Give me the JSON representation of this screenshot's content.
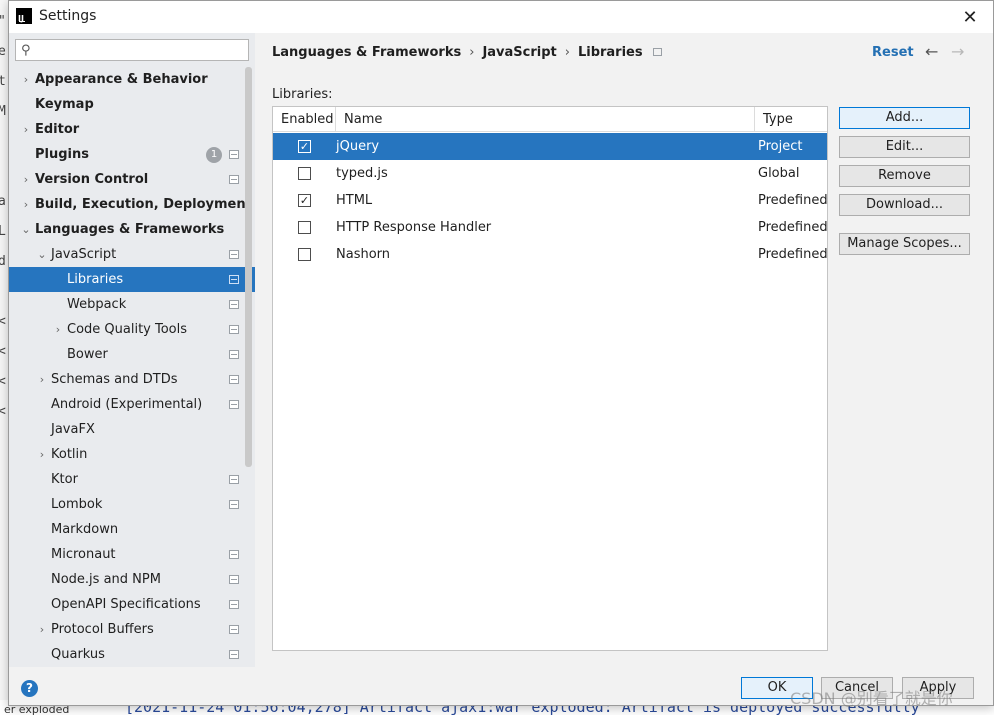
{
  "window": {
    "title": "Settings",
    "close_glyph": "✕"
  },
  "background": {
    "left_glyphs": [
      "\"",
      "e",
      "t",
      "M",
      "",
      "",
      "a",
      "L",
      "d",
      "",
      "<",
      "<",
      "<",
      "<"
    ],
    "bottom_left": "er exploded",
    "bottom_log": "[2021-11-24 01:56:04,278] Artifact ajax1:war exploded: Artifact is deployed successfully"
  },
  "sidebar": {
    "search_placeholder": "",
    "items": [
      {
        "label": "Appearance & Behavior",
        "bold": true,
        "chevron": "›",
        "indent": 0,
        "config": false
      },
      {
        "label": "Keymap",
        "bold": true,
        "chevron": "",
        "indent": 0,
        "config": false
      },
      {
        "label": "Editor",
        "bold": true,
        "chevron": "›",
        "indent": 0,
        "config": false
      },
      {
        "label": "Plugins",
        "bold": true,
        "chevron": "",
        "indent": 0,
        "config": true,
        "badge": "1"
      },
      {
        "label": "Version Control",
        "bold": true,
        "chevron": "›",
        "indent": 0,
        "config": true
      },
      {
        "label": "Build, Execution, Deployment",
        "bold": true,
        "chevron": "›",
        "indent": 0,
        "config": false
      },
      {
        "label": "Languages & Frameworks",
        "bold": true,
        "chevron": "⌄",
        "indent": 0,
        "config": false
      },
      {
        "label": "JavaScript",
        "bold": false,
        "chevron": "⌄",
        "indent": 1,
        "config": true
      },
      {
        "label": "Libraries",
        "bold": false,
        "chevron": "",
        "indent": 2,
        "config": true,
        "selected": true
      },
      {
        "label": "Webpack",
        "bold": false,
        "chevron": "",
        "indent": 2,
        "config": true
      },
      {
        "label": "Code Quality Tools",
        "bold": false,
        "chevron": "›",
        "indent": 2,
        "config": true
      },
      {
        "label": "Bower",
        "bold": false,
        "chevron": "",
        "indent": 2,
        "config": true
      },
      {
        "label": "Schemas and DTDs",
        "bold": false,
        "chevron": "›",
        "indent": 1,
        "config": true
      },
      {
        "label": "Android (Experimental)",
        "bold": false,
        "chevron": "",
        "indent": 1,
        "config": true
      },
      {
        "label": "JavaFX",
        "bold": false,
        "chevron": "",
        "indent": 1,
        "config": false
      },
      {
        "label": "Kotlin",
        "bold": false,
        "chevron": "›",
        "indent": 1,
        "config": false
      },
      {
        "label": "Ktor",
        "bold": false,
        "chevron": "",
        "indent": 1,
        "config": true
      },
      {
        "label": "Lombok",
        "bold": false,
        "chevron": "",
        "indent": 1,
        "config": true
      },
      {
        "label": "Markdown",
        "bold": false,
        "chevron": "",
        "indent": 1,
        "config": false
      },
      {
        "label": "Micronaut",
        "bold": false,
        "chevron": "",
        "indent": 1,
        "config": true
      },
      {
        "label": "Node.js and NPM",
        "bold": false,
        "chevron": "",
        "indent": 1,
        "config": true
      },
      {
        "label": "OpenAPI Specifications",
        "bold": false,
        "chevron": "",
        "indent": 1,
        "config": true
      },
      {
        "label": "Protocol Buffers",
        "bold": false,
        "chevron": "›",
        "indent": 1,
        "config": true
      },
      {
        "label": "Quarkus",
        "bold": false,
        "chevron": "",
        "indent": 1,
        "config": true
      }
    ]
  },
  "main": {
    "breadcrumb": [
      "Languages & Frameworks",
      "JavaScript",
      "Libraries"
    ],
    "breadcrumb_sep": "›",
    "reset_label": "Reset",
    "back_glyph": "←",
    "forward_glyph": "→",
    "libraries_label": "Libraries:",
    "table": {
      "headers": {
        "enabled": "Enabled",
        "name": "Name",
        "type": "Type"
      },
      "rows": [
        {
          "enabled": true,
          "name": "jQuery",
          "type": "Project",
          "selected": true
        },
        {
          "enabled": false,
          "name": "typed.js",
          "type": "Global",
          "selected": false
        },
        {
          "enabled": true,
          "name": "HTML",
          "type": "Predefined",
          "selected": false
        },
        {
          "enabled": false,
          "name": "HTTP Response Handler",
          "type": "Predefined",
          "selected": false
        },
        {
          "enabled": false,
          "name": "Nashorn",
          "type": "Predefined",
          "selected": false
        }
      ]
    },
    "buttons": {
      "add": "Add...",
      "edit": "Edit...",
      "remove": "Remove",
      "download": "Download...",
      "manage_scopes": "Manage Scopes..."
    }
  },
  "footer": {
    "help": "?",
    "ok": "OK",
    "cancel": "Cancel",
    "apply": "Apply"
  },
  "watermark": "CSDN @别看了就是你",
  "colors": {
    "selection": "#2675bf",
    "link": "#2470b3"
  }
}
